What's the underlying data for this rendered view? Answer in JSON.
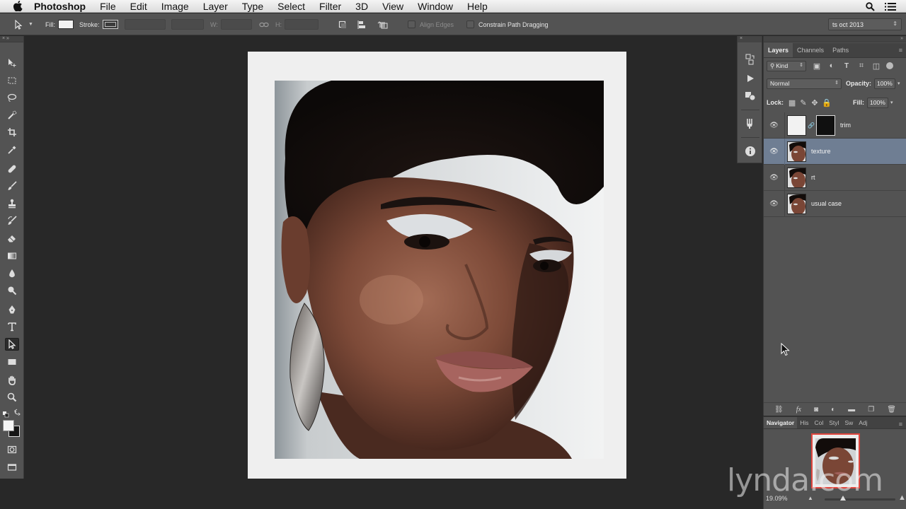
{
  "menubar": {
    "app_name": "Photoshop",
    "items": [
      "File",
      "Edit",
      "Image",
      "Layer",
      "Type",
      "Select",
      "Filter",
      "3D",
      "View",
      "Window",
      "Help"
    ]
  },
  "options_bar": {
    "fill_label": "Fill:",
    "stroke_label": "Stroke:",
    "width_label": "W:",
    "height_label": "H:",
    "align_edges": "Align Edges",
    "constrain_path": "Constrain Path Dragging",
    "workspace": "ts oct 2013"
  },
  "layers_panel": {
    "tabs": [
      "Layers",
      "Channels",
      "Paths"
    ],
    "filter_kind": "Kind",
    "blend_mode": "Normal",
    "opacity_label": "Opacity:",
    "opacity": "100%",
    "lock_label": "Lock:",
    "fill_label": "Fill:",
    "fill": "100%",
    "layers": [
      {
        "name": "trim",
        "thumb": "white-with-mask",
        "visible": true,
        "selected": false
      },
      {
        "name": "texture",
        "thumb": "portrait",
        "visible": true,
        "selected": true
      },
      {
        "name": "rt",
        "thumb": "portrait",
        "visible": true,
        "selected": false
      },
      {
        "name": "usual case",
        "thumb": "portrait",
        "visible": true,
        "selected": false
      }
    ]
  },
  "navigator": {
    "tabs": [
      "Navigator",
      "His",
      "Col",
      "Styl",
      "Sw",
      "Adj"
    ],
    "zoom": "19.09%"
  },
  "watermark": "lynda.com",
  "colors": {
    "panel_bg": "#535353",
    "canvas_bg": "#282828",
    "selected_layer": "#6f7e93",
    "navigator_frame": "#e0453d"
  }
}
